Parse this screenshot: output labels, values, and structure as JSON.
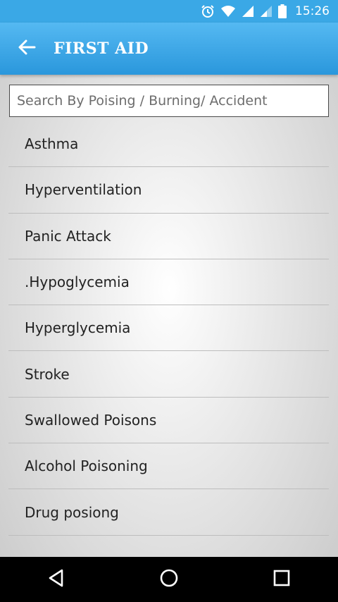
{
  "status_bar": {
    "time": "15:26",
    "icons": [
      "alarm-icon",
      "wifi-icon",
      "signal-icon",
      "signal-weak-icon",
      "battery-icon"
    ]
  },
  "app_bar": {
    "title": "FIRST AID",
    "back_icon": "arrow-left-icon"
  },
  "search": {
    "placeholder": "Search By Poising / Burning/ Accident",
    "value": ""
  },
  "list": {
    "items": [
      {
        "label": "Asthma"
      },
      {
        "label": "Hyperventilation"
      },
      {
        "label": "Panic Attack"
      },
      {
        "label": ".Hypoglycemia"
      },
      {
        "label": "Hyperglycemia"
      },
      {
        "label": "Stroke"
      },
      {
        "label": "Swallowed Poisons"
      },
      {
        "label": "Alcohol Poisoning"
      },
      {
        "label": "Drug posiong"
      }
    ]
  },
  "nav_bar": {
    "buttons": [
      "back-triangle-icon",
      "home-circle-icon",
      "recents-square-icon"
    ]
  },
  "colors": {
    "accent": "#2a97dc",
    "status_bar": "#3aa8e6",
    "nav_bar": "#000000"
  }
}
